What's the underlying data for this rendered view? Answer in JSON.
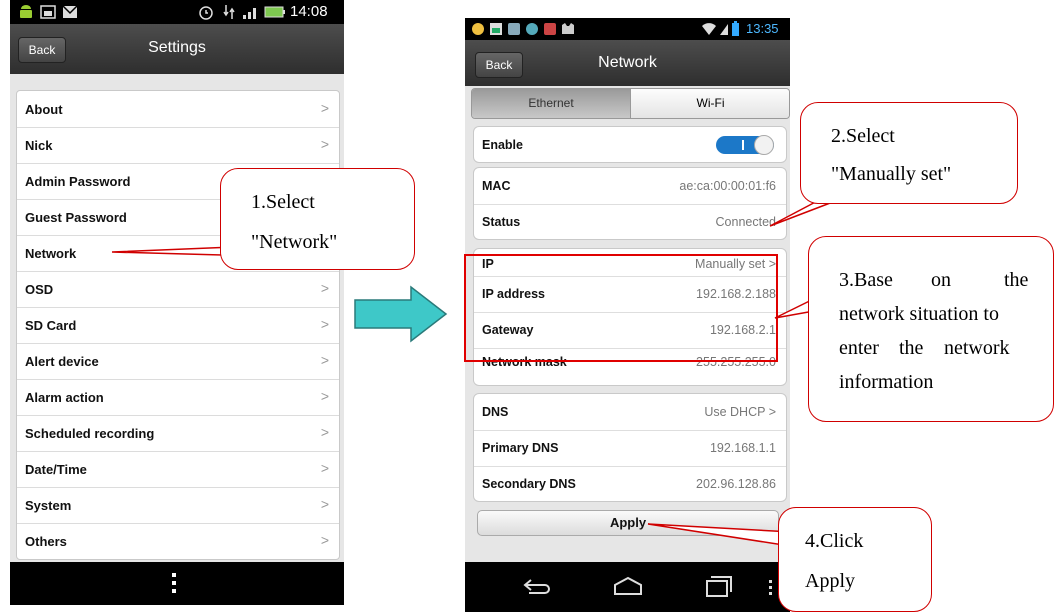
{
  "colors": {
    "callout_border": "#d00000",
    "toggle_on": "#1c78c8",
    "arrow_fill": "#3ec8c8",
    "status_bar": "#000000"
  },
  "phone1": {
    "status_time": "14:08",
    "status_icons_left": [
      "android-icon",
      "image-icon",
      "mail-icon"
    ],
    "status_icons_right": [
      "alarm-icon",
      "data-icon",
      "signal-icon",
      "battery-icon"
    ],
    "back_label": "Back",
    "title": "Settings",
    "menu": [
      {
        "label": "About"
      },
      {
        "label": "Nick"
      },
      {
        "label": "Admin Password"
      },
      {
        "label": "Guest Password"
      },
      {
        "label": "Network"
      },
      {
        "label": "OSD"
      },
      {
        "label": "SD Card"
      },
      {
        "label": "Alert device"
      },
      {
        "label": "Alarm action"
      },
      {
        "label": "Scheduled recording"
      },
      {
        "label": "Date/Time"
      },
      {
        "label": "System"
      },
      {
        "label": "Others"
      }
    ],
    "chevron": ">",
    "overflow_icon": "more-vertical-icon"
  },
  "phone2": {
    "status_time": "13:35",
    "back_label": "Back",
    "title": "Network",
    "tabs": [
      {
        "label": "Ethernet",
        "active": true
      },
      {
        "label": "Wi-Fi",
        "active": false
      }
    ],
    "enable": {
      "label": "Enable",
      "toggle_text": "I",
      "on": true
    },
    "mac": {
      "label": "MAC",
      "value": "ae:ca:00:00:01:f6"
    },
    "status": {
      "label": "Status",
      "value": "Connected"
    },
    "ip": {
      "label": "IP",
      "value": "Manually set >"
    },
    "ip_address": {
      "label": "IP address",
      "value": "192.168.2.188"
    },
    "gateway": {
      "label": "Gateway",
      "value": "192.168.2.1"
    },
    "network_mask": {
      "label": "Network mask",
      "value": "255.255.255.0"
    },
    "dns": {
      "label": "DNS",
      "value": "Use DHCP >"
    },
    "primary_dns": {
      "label": "Primary DNS",
      "value": "192.168.1.1"
    },
    "secondary_dns": {
      "label": "Secondary DNS",
      "value": "202.96.128.86"
    },
    "apply_label": "Apply",
    "nav_icons": [
      "back-icon",
      "home-icon",
      "recent-apps-icon"
    ]
  },
  "callouts": {
    "c1": {
      "line1": "1.Select",
      "line2": "\"Network\""
    },
    "c2": {
      "line1": "2.Select",
      "line2": "\"Manually set\""
    },
    "c3": {
      "line1a": "3.Base",
      "line1b": "on",
      "line1c": "the",
      "line2": "network situation to",
      "line3a": "enter",
      "line3b": "the",
      "line3c": "network",
      "line4": "information"
    },
    "c4": {
      "line1": "4.Click",
      "line2": "Apply"
    }
  }
}
